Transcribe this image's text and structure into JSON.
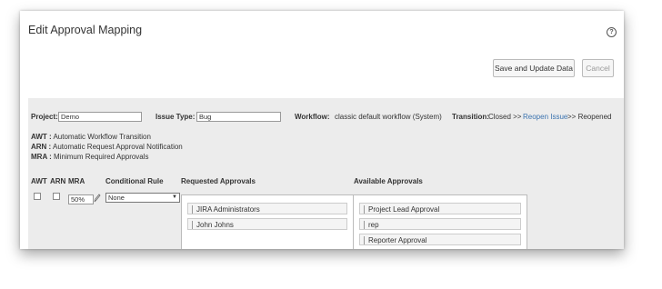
{
  "dialog": {
    "title": "Edit Approval Mapping",
    "save_label": "Save and Update Data",
    "cancel_label": "Cancel"
  },
  "fields": {
    "project_label": "Project:",
    "project_value": "Demo",
    "issue_type_label": "Issue Type:",
    "issue_type_value": "Bug",
    "workflow_label": "Workflow:",
    "workflow_value": "classic default workflow (System)",
    "transition_label": "Transition:",
    "transition_from": "Closed >>",
    "transition_link": "Reopen Issue",
    "transition_to": ">> Reopened"
  },
  "legend": [
    {
      "key": "AWT :",
      "text": "Automatic Workflow Transition"
    },
    {
      "key": "ARN :",
      "text": "Automatic Request Approval Notification"
    },
    {
      "key": "MRA :",
      "text": "Minimum Required Approvals"
    }
  ],
  "columns": {
    "awt": "AWT",
    "arn": "ARN",
    "mra": "MRA",
    "conditional_rule": "Conditional Rule",
    "requested": "Requested Approvals",
    "available": "Available Approvals"
  },
  "row": {
    "mra_value": "50%",
    "conditional_rule_value": "None"
  },
  "requested_approvals": [
    "JIRA Administrators",
    "John Johns"
  ],
  "available_approvals": [
    "Project Lead Approval",
    "rep",
    "Reporter Approval"
  ]
}
